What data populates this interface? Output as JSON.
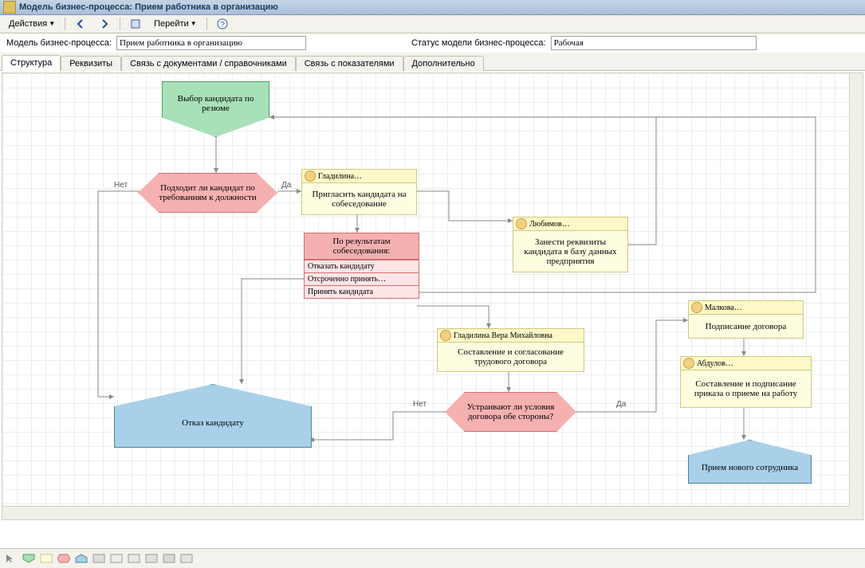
{
  "window_title": "Модель бизнес-процесса: Прием работника в организацию",
  "toolbar": {
    "actions_label": "Действия",
    "goto_label": "Перейти"
  },
  "form": {
    "model_label": "Модель бизнес-процесса:",
    "model_value": "Прием работника в организацию",
    "status_label": "Статус модели бизнес-процесса:",
    "status_value": "Рабочая"
  },
  "tabs": [
    {
      "label": "Структура",
      "active": true
    },
    {
      "label": "Реквизиты",
      "active": false
    },
    {
      "label": "Связь с документами / справочниками",
      "active": false
    },
    {
      "label": "Связь с показателями",
      "active": false
    },
    {
      "label": "Дополнительно",
      "active": false
    }
  ],
  "diagram": {
    "nodes": {
      "start": {
        "text": "Выбор кандидата по резюме"
      },
      "dec1": {
        "text": "Подходит ли кандидат по требованиям к должности"
      },
      "dec1_no": "Нет",
      "dec1_yes": "Да",
      "task_invite": {
        "owner": "Гладилина…",
        "text": "Пригласить кандидата на собеседование"
      },
      "task_db": {
        "owner": "Любимов…",
        "text": "Занести реквизиты кандидата в базу данных предприятия"
      },
      "switch": {
        "title": "По результатам собеседования:",
        "opt1": "Отказать кандидату",
        "opt2": "Отсроченно принять…",
        "opt3": "Принять кандидата"
      },
      "task_contract": {
        "owner": "Гладилина Вера Михайловна",
        "text": "Составление и согласование трудового договора"
      },
      "dec2": {
        "text": "Устраивают ли условия договора обе стороны?"
      },
      "dec2_no": "Нет",
      "dec2_yes": "Да",
      "task_sign": {
        "owner": "Малкова…",
        "text": "Подписание договора"
      },
      "task_order": {
        "owner": "Абдулов…",
        "text": "Составление и подписание приказа о приеме на работу"
      },
      "end_reject": {
        "text": "Отказ кандидату"
      },
      "end_accept": {
        "text": "Прием нового сотрудника"
      }
    }
  }
}
